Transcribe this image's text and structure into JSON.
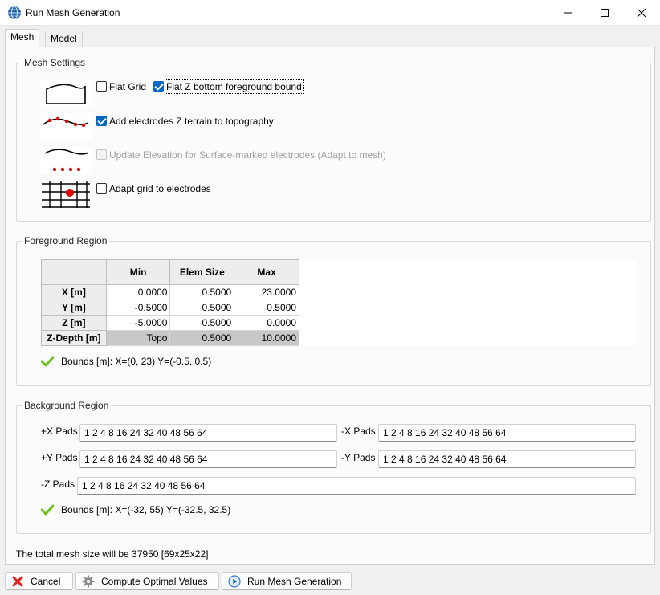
{
  "window": {
    "title": "Run Mesh Generation"
  },
  "tabs": [
    {
      "label": "Mesh"
    },
    {
      "label": "Model"
    }
  ],
  "mesh_settings": {
    "title": "Mesh Settings",
    "flat_grid": {
      "label": "Flat Grid",
      "checked": false
    },
    "flat_z_bottom": {
      "label": "Flat Z bottom foreground bound",
      "checked": true
    },
    "add_electrodes": {
      "label": "Add electrodes Z terrain to topography",
      "checked": true
    },
    "update_elevation": {
      "label": "Update Elevation for Surface-marked electrodes (Adapt to mesh)",
      "checked": false,
      "disabled": true
    },
    "adapt_grid": {
      "label": "Adapt grid to electrodes",
      "checked": false
    }
  },
  "foreground": {
    "title": "Foreground Region",
    "headers": [
      "Min",
      "Elem Size",
      "Max"
    ],
    "rows": [
      {
        "label": "X [m]",
        "min": "0.0000",
        "elem": "0.5000",
        "max": "23.0000"
      },
      {
        "label": "Y [m]",
        "min": "-0.5000",
        "elem": "0.5000",
        "max": "0.5000"
      },
      {
        "label": "Z [m]",
        "min": "-5.0000",
        "elem": "0.5000",
        "max": "0.0000"
      },
      {
        "label": "Z-Depth [m]",
        "min": "Topo",
        "elem": "0.5000",
        "max": "10.0000"
      }
    ],
    "bounds": "Bounds [m]: X=(0, 23) Y=(-0.5, 0.5)"
  },
  "background": {
    "title": "Background Region",
    "px_label": "+X Pads",
    "px_value": "1 2 4 8 16 24 32 40 48 56 64",
    "nx_label": "-X Pads",
    "nx_value": "1 2 4 8 16 24 32 40 48 56 64",
    "py_label": "+Y Pads",
    "py_value": "1 2 4 8 16 24 32 40 48 56 64",
    "ny_label": "-Y Pads",
    "ny_value": "1 2 4 8 16 24 32 40 48 56 64",
    "nz_label": "-Z Pads",
    "nz_value": "1 2 4 8 16 24 32 40 48 56 64",
    "bounds": "Bounds [m]: X=(-32, 55) Y=(-32.5, 32.5)"
  },
  "status": {
    "text": "The total mesh size will be 37950 [69x25x22]"
  },
  "buttons": {
    "cancel": "Cancel",
    "compute": "Compute Optimal Values",
    "run": "Run Mesh Generation"
  },
  "colors": {
    "accent": "#0067c0",
    "electrode": "#e00000",
    "check": "#6cbf1c"
  }
}
